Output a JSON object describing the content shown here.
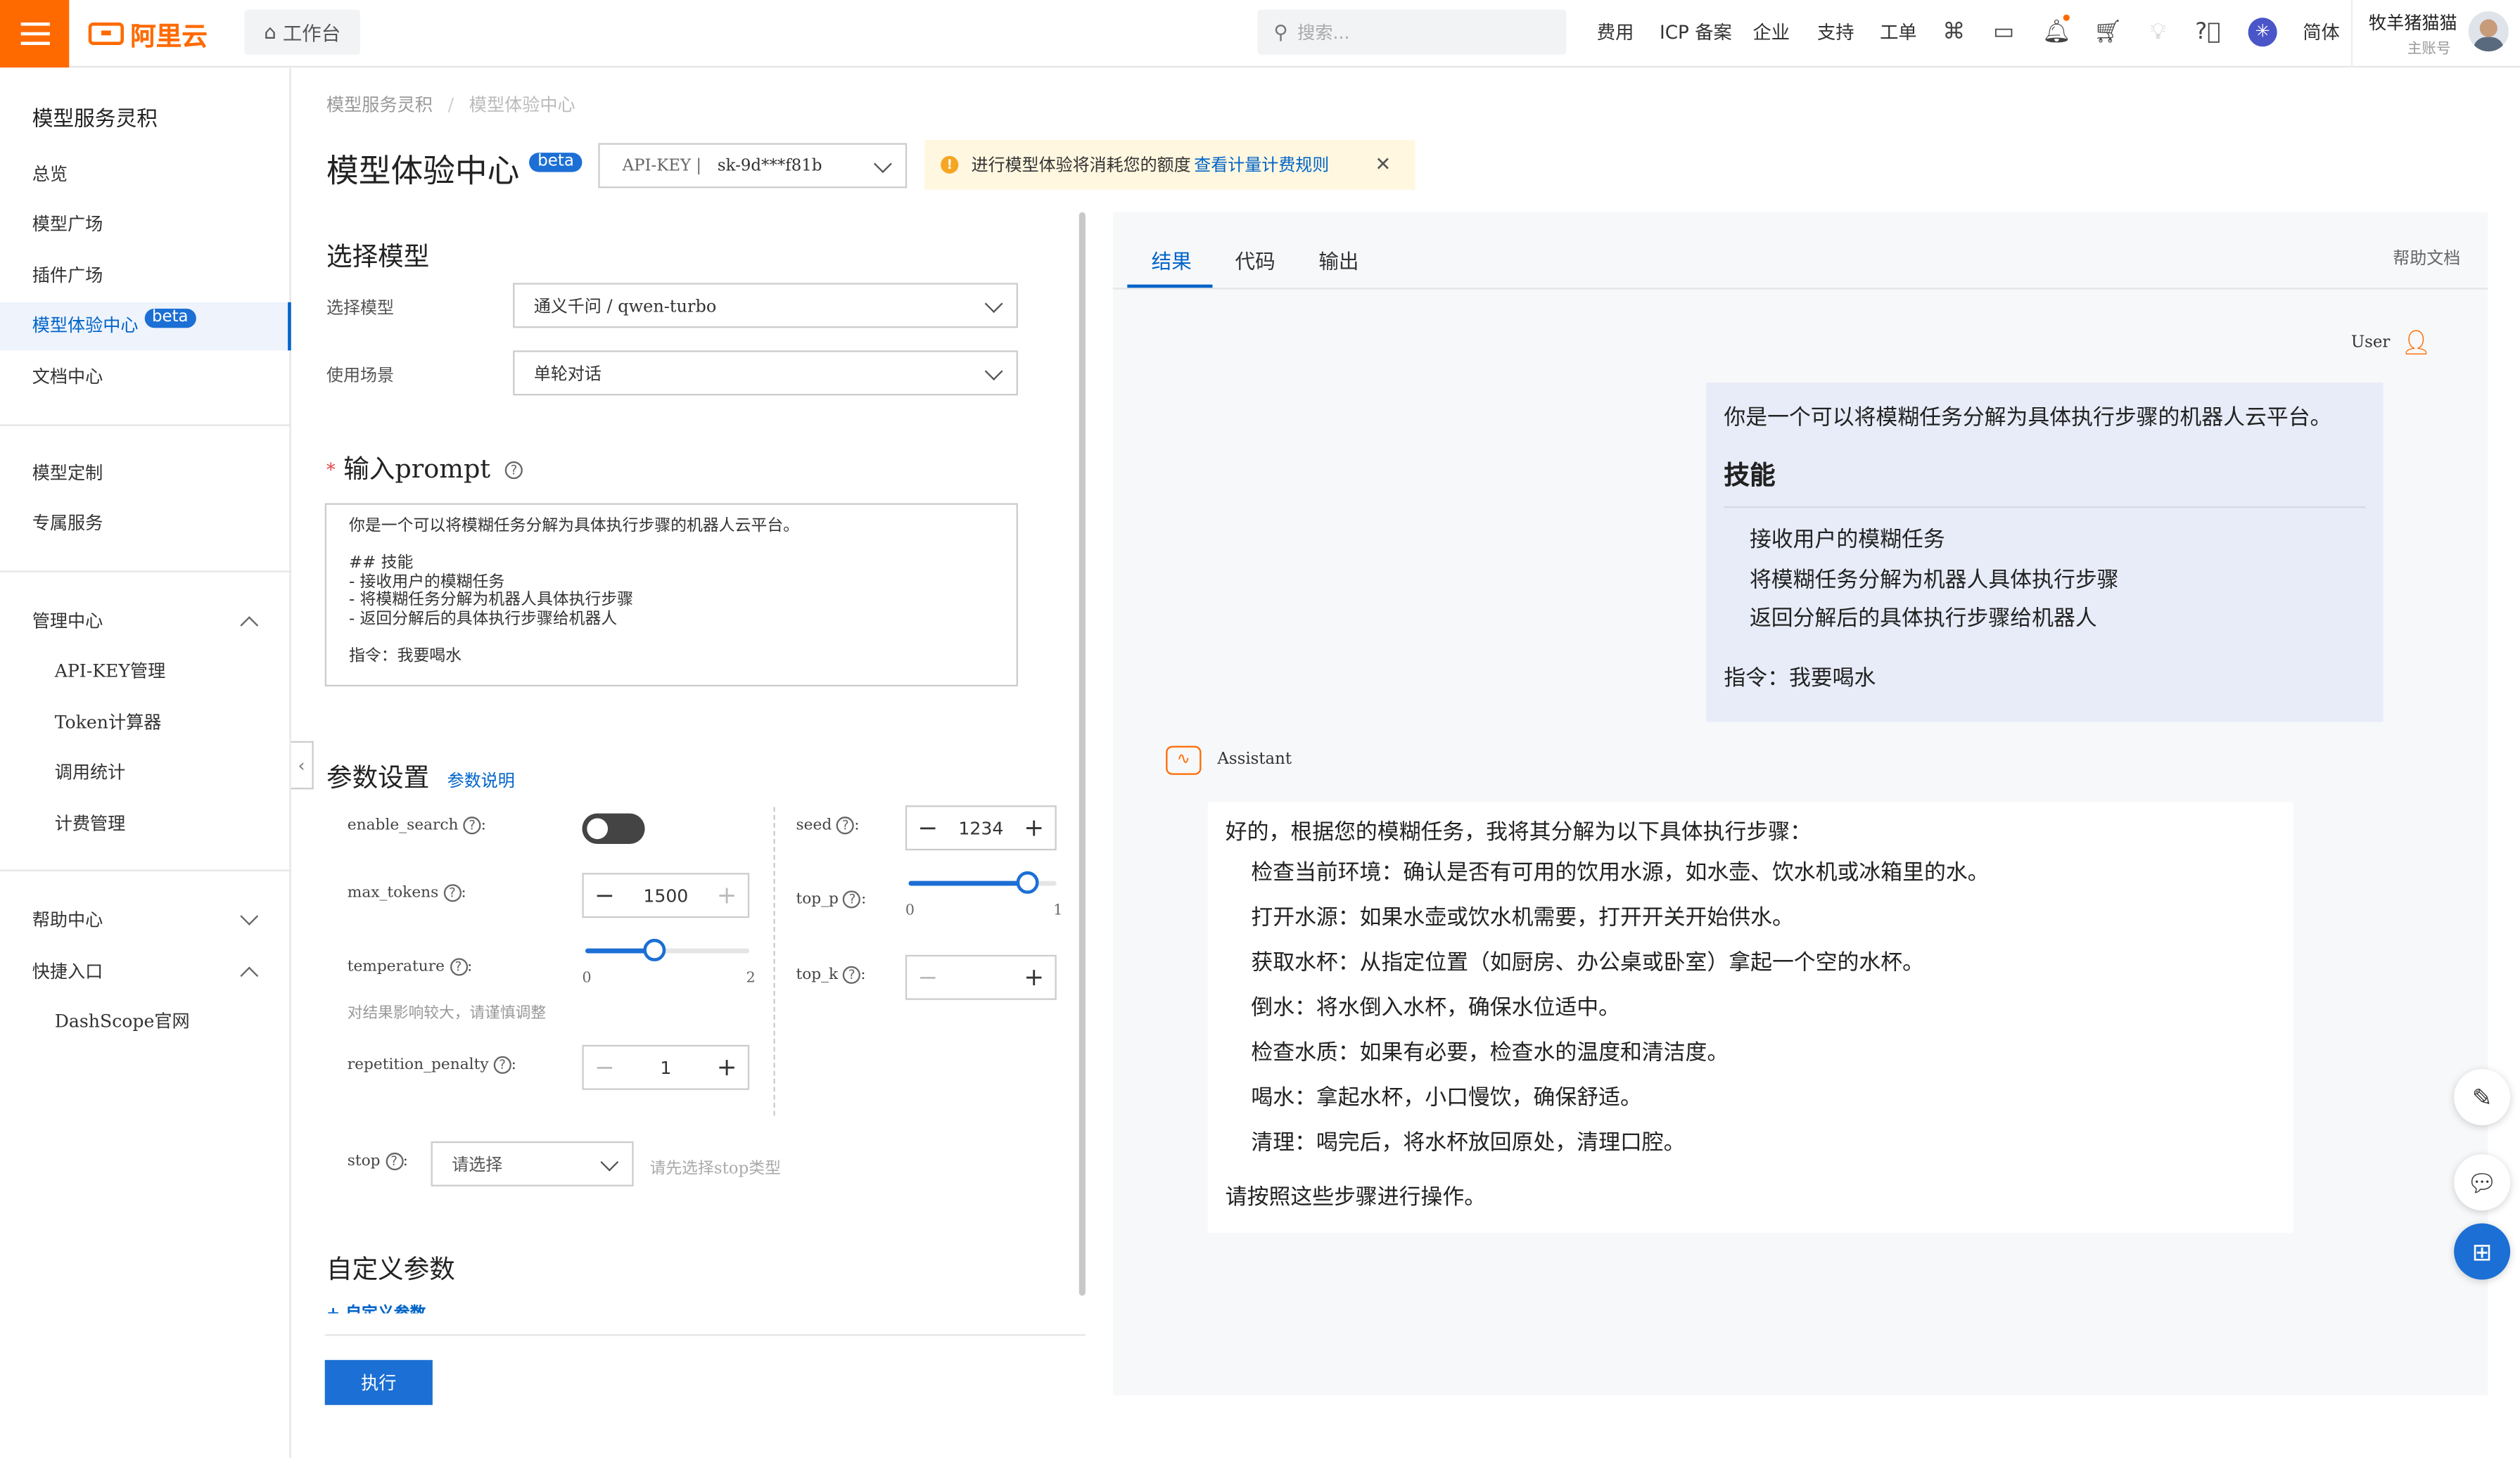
{
  "topbar": {
    "logo_text": "阿里云",
    "workbench_label": "工作台",
    "search_placeholder": "搜索...",
    "nav": [
      "费用",
      "ICP 备案",
      "企业",
      "支持",
      "工单"
    ],
    "language": "简体",
    "user_name": "牧羊猪猫猫",
    "user_role": "主账号"
  },
  "sidebar": {
    "title": "模型服务灵积",
    "items": [
      "总览",
      "模型广场",
      "插件广场",
      "模型体验中心",
      "文档中心"
    ],
    "beta": "beta",
    "items2": [
      "模型定制",
      "专属服务"
    ],
    "manage_header": "管理中心",
    "manage_items": [
      "API-KEY管理",
      "Token计算器",
      "调用统计",
      "计费管理"
    ],
    "help_header": "帮助中心",
    "quick_header": "快捷入口",
    "quick_items": [
      "DashScope官网"
    ]
  },
  "breadcrumb": {
    "root": "模型服务灵积",
    "sep": "/",
    "current": "模型体验中心"
  },
  "page": {
    "title": "模型体验中心",
    "beta": "beta",
    "apikey_label": "API-KEY |",
    "apikey_value": "sk-9d***f81b",
    "notice_text": "进行模型体验将消耗您的额度",
    "notice_link": "查看计量计费规则"
  },
  "model_section": {
    "title": "选择模型",
    "model_label": "选择模型",
    "model_value": "通义千问 / qwen-turbo",
    "scene_label": "使用场景",
    "scene_value": "单轮对话"
  },
  "prompt": {
    "required_mark": "*",
    "title": "输入prompt",
    "lines": [
      "你是一个可以将模糊任务分解为具体执行步骤的机器人云平台。",
      "",
      "## 技能",
      "- 接收用户的模糊任务",
      "- 将模糊任务分解为机器人具体执行步骤",
      "- 返回分解后的具体执行步骤给机器人",
      "",
      "指令：我要喝水"
    ]
  },
  "params": {
    "title": "参数设置",
    "link": "参数说明",
    "enable_search_label": "enable_search",
    "enable_search_on": false,
    "max_tokens_label": "max_tokens",
    "max_tokens_value": "1500",
    "temperature_label": "temperature",
    "temperature_min": "0",
    "temperature_max": "2",
    "temperature_value": 0.85,
    "temperature_hint": "对结果影响较大，请谨慎调整",
    "repetition_penalty_label": "repetition_penalty",
    "repetition_penalty_value": "1",
    "seed_label": "seed",
    "seed_value": "1234",
    "top_p_label": "top_p",
    "top_p_min": "0",
    "top_p_max": "1",
    "top_p_value": 0.8,
    "top_k_label": "top_k",
    "stop_label": "stop",
    "stop_placeholder": "请选择",
    "stop_hint": "请先选择stop类型",
    "colon": ":"
  },
  "custom": {
    "title": "自定义参数",
    "add_label": "+ 自定义参数"
  },
  "run_label": "执行",
  "result": {
    "tabs": [
      "结果",
      "代码",
      "输出"
    ],
    "help_link": "帮助文档",
    "user_label": "User",
    "user_intro": "你是一个可以将模糊任务分解为具体执行步骤的机器人云平台。",
    "user_heading": "技能",
    "user_items": [
      "接收用户的模糊任务",
      "将模糊任务分解为机器人具体执行步骤",
      "返回分解后的具体执行步骤给机器人"
    ],
    "user_instruction": "指令：我要喝水",
    "assistant_label": "Assistant",
    "assistant_intro": "好的，根据您的模糊任务，我将其分解为以下具体执行步骤：",
    "assistant_steps": [
      "检查当前环境：确认是否有可用的饮用水源，如水壶、饮水机或冰箱里的水。",
      "打开水源：如果水壶或饮水机需要，打开开关开始供水。",
      "获取水杯：从指定位置（如厨房、办公桌或卧室）拿起一个空的水杯。",
      "倒水：将水倒入水杯，确保水位适中。",
      "检查水质：如果有必要，检查水的温度和清洁度。",
      "喝水：拿起水杯，小口慢饮，确保舒适。",
      "清理：喝完后，将水杯放回原处，清理口腔。"
    ],
    "assistant_outro": "请按照这些步骤进行操作。"
  },
  "colors": {
    "brand": "#ff6a00",
    "primary": "#1c6fd4",
    "notice_bg": "#fff7e0"
  }
}
